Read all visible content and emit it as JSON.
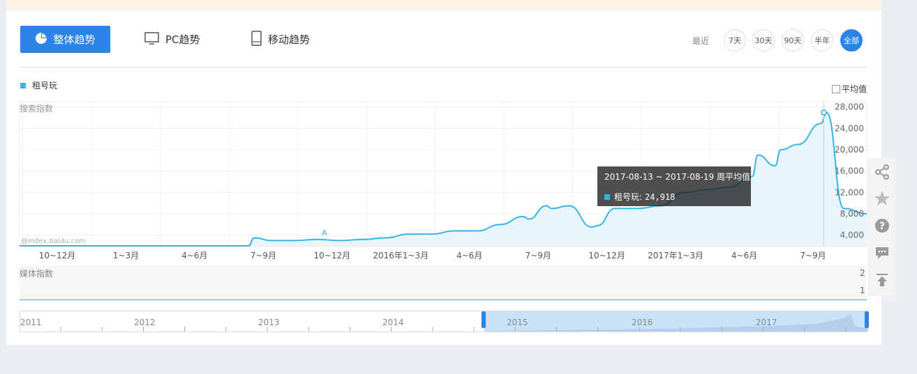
{
  "tabs": {
    "overall": "整体趋势",
    "pc": "PC趋势",
    "mobile": "移动趋势"
  },
  "range": {
    "label": "最近",
    "options": [
      "7天",
      "30天",
      "90天",
      "半年",
      "全部"
    ],
    "active": "全部"
  },
  "legend": {
    "series_name": "租号玩",
    "average_toggle": "平均值"
  },
  "watermark": "@index.baidu.com",
  "search_panel_title": "搜索指数",
  "media_panel": {
    "title": "媒体指数",
    "ticks": [
      "2",
      "1"
    ]
  },
  "tooltip": {
    "header": "2017-08-13 ~ 2017-08-19 周平均值",
    "series": "租号玩:",
    "value": "24,918"
  },
  "timeline": {
    "years": [
      "2011",
      "2012",
      "2013",
      "2014",
      "2015",
      "2016",
      "2017"
    ]
  },
  "colors": {
    "accent": "#2c83e8",
    "series": "#35b4e7"
  },
  "side_tools": [
    "share-icon",
    "star-icon",
    "help-icon",
    "comment-icon",
    "back-to-top-icon"
  ],
  "chart_data": {
    "type": "area",
    "title": "",
    "ylabel": "搜索指数",
    "y_ticks": [
      "4,000",
      "8,000",
      "12,000",
      "16,000",
      "20,000",
      "24,000",
      "28,000"
    ],
    "ylim": [
      2000,
      29000
    ],
    "x_ticks": [
      "10~12月",
      "1~3月",
      "4~6月",
      "7~9月",
      "10~12月",
      "2016年1~3月",
      "4~6月",
      "7~9月",
      "10~12月",
      "2017年1~3月",
      "4~6月",
      "7~9月"
    ],
    "annotation": "A",
    "series": [
      {
        "name": "租号玩",
        "x": [
          "2014-09",
          "2014-11",
          "2015-01",
          "2015-03",
          "2015-05",
          "2015-07",
          "2015-07",
          "2015-08",
          "2015-09",
          "2015-10",
          "2015-11",
          "2015-12",
          "2016-01",
          "2016-02",
          "2016-03",
          "2016-04",
          "2016-05",
          "2016-06",
          "2016-07",
          "2016-07",
          "2016-08",
          "2016-08",
          "2016-09",
          "2016-10",
          "2016-10",
          "2016-11",
          "2016-12",
          "2017-01",
          "2017-02",
          "2017-03",
          "2017-04",
          "2017-05",
          "2017-05",
          "2017-06",
          "2017-06",
          "2017-07",
          "2017-08",
          "2017-08",
          "2017-09",
          "2017-10"
        ],
        "y": [
          2000,
          2000,
          2000,
          2000,
          2000,
          2000,
          3500,
          3000,
          3000,
          3200,
          3000,
          3200,
          3500,
          4200,
          4200,
          4800,
          4800,
          6000,
          7500,
          7000,
          9500,
          9000,
          9500,
          5500,
          5800,
          9000,
          9000,
          9500,
          12000,
          12500,
          13000,
          15000,
          19000,
          17000,
          20000,
          21000,
          24918,
          27000,
          9000,
          8000
        ]
      }
    ]
  }
}
